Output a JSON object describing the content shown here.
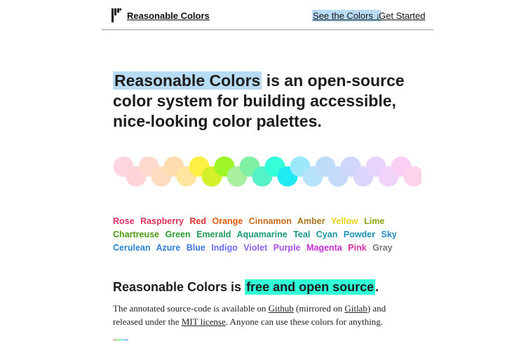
{
  "header": {
    "brand": "Reasonable Colors",
    "nav": [
      {
        "label": "See the Colors ↓"
      },
      {
        "label": "Get Started"
      }
    ]
  },
  "hero": {
    "highlight": "Reasonable Colors",
    "rest": " is an open-source color system for building accessible, nice-looking color palettes."
  },
  "circles": [
    {
      "name": "rose",
      "color": "#ffd6e0"
    },
    {
      "name": "raspberry",
      "color": "#ffd3d8"
    },
    {
      "name": "red",
      "color": "#ffd9cd"
    },
    {
      "name": "orange",
      "color": "#ffdcc0"
    },
    {
      "name": "cinnamon",
      "color": "#ffdcb0"
    },
    {
      "name": "amber",
      "color": "#ffe6a0"
    },
    {
      "name": "yellow",
      "color": "#fdef44"
    },
    {
      "name": "lime",
      "color": "#d4f02a"
    },
    {
      "name": "chartreuse",
      "color": "#9df528"
    },
    {
      "name": "green",
      "color": "#a8ef9e"
    },
    {
      "name": "emerald",
      "color": "#7ff0a4"
    },
    {
      "name": "aquamarine",
      "color": "#55f2c8"
    },
    {
      "name": "teal",
      "color": "#35ffd8"
    },
    {
      "name": "cyan",
      "color": "#1fe9f3"
    },
    {
      "name": "powder",
      "color": "#9be9f8"
    },
    {
      "name": "sky",
      "color": "#b7e2fc"
    },
    {
      "name": "cerulean",
      "color": "#bedcfa"
    },
    {
      "name": "azure",
      "color": "#c5d9fb"
    },
    {
      "name": "blue",
      "color": "#d1d6fc"
    },
    {
      "name": "indigo",
      "color": "#dcd6fd"
    },
    {
      "name": "violet",
      "color": "#e6d4fd"
    },
    {
      "name": "purple",
      "color": "#f0d3fb"
    },
    {
      "name": "magenta",
      "color": "#fad1f4"
    },
    {
      "name": "pink",
      "color": "#ffd3ea"
    }
  ],
  "color_names": [
    {
      "label": "Rose",
      "color": "#e0306a"
    },
    {
      "label": "Raspberry",
      "color": "#e0315a"
    },
    {
      "label": "Red",
      "color": "#e3312f"
    },
    {
      "label": "Orange",
      "color": "#e05d10"
    },
    {
      "label": "Cinnamon",
      "color": "#c86a1a"
    },
    {
      "label": "Amber",
      "color": "#a7751a"
    },
    {
      "label": "Yellow",
      "color": "#e5d31c"
    },
    {
      "label": "Lime",
      "color": "#8aa412"
    },
    {
      "label": "Chartreuse",
      "color": "#4e9a12"
    },
    {
      "label": "Green",
      "color": "#2a9a2e"
    },
    {
      "label": "Emerald",
      "color": "#1c9a55"
    },
    {
      "label": "Aquamarine",
      "color": "#17997a"
    },
    {
      "label": "Teal",
      "color": "#14998c"
    },
    {
      "label": "Cyan",
      "color": "#1595a7"
    },
    {
      "label": "Powder",
      "color": "#1c90b3"
    },
    {
      "label": "Sky",
      "color": "#258ac4"
    },
    {
      "label": "Cerulean",
      "color": "#2a86d2"
    },
    {
      "label": "Azure",
      "color": "#2f7ddf"
    },
    {
      "label": "Blue",
      "color": "#3d74ea"
    },
    {
      "label": "Indigo",
      "color": "#6b6ff0"
    },
    {
      "label": "Violet",
      "color": "#8d63ee"
    },
    {
      "label": "Purple",
      "color": "#a752ea"
    },
    {
      "label": "Magenta",
      "color": "#c62ed3"
    },
    {
      "label": "Pink",
      "color": "#d8309f"
    },
    {
      "label": "Gray",
      "color": "#777777"
    }
  ],
  "section": {
    "title_before": "Reasonable Colors is ",
    "title_highlight": "free and open source",
    "title_after": ".",
    "para": {
      "t1": "The annotated source-code is available on ",
      "github": "Github",
      "t2": " (mirrored on ",
      "gitlab": "Gitlab",
      "t3": ") and released under the ",
      "mit": "MIT license",
      "t4": ". Anyone can use these colors for anything."
    }
  },
  "accent": "#b9dcf5",
  "accent_source": "#31ffd8"
}
